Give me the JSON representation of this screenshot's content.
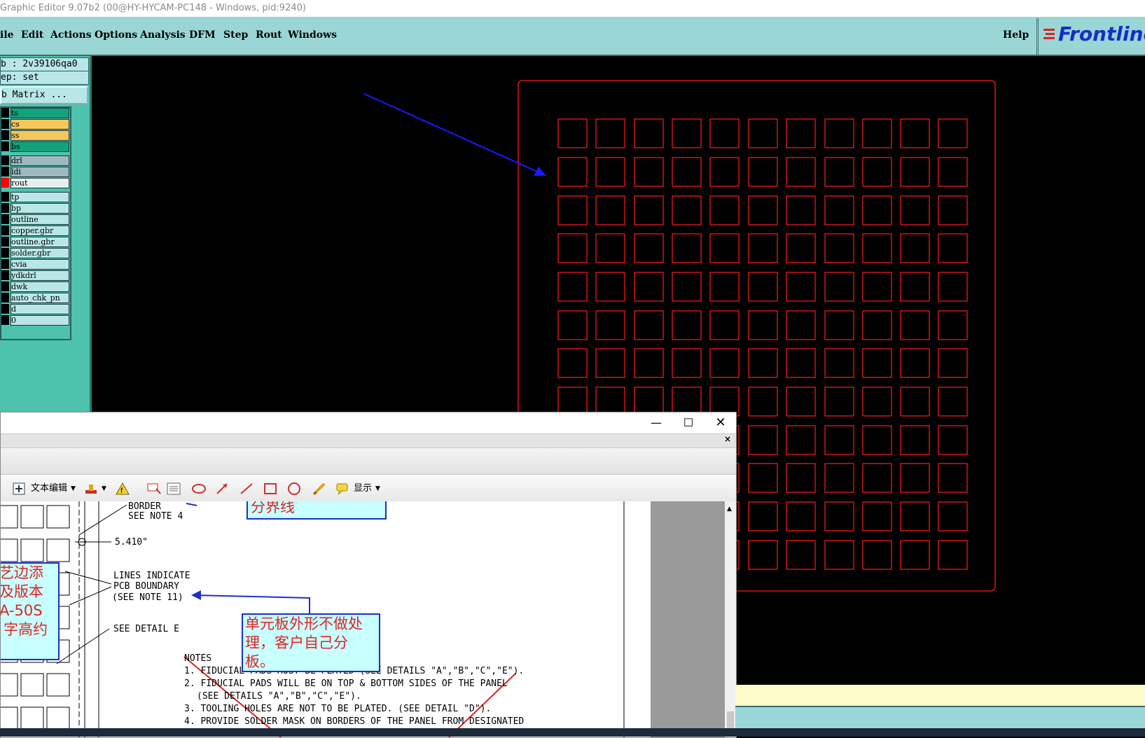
{
  "window": {
    "title": "Graphic Editor 9.07b2 (00@HY-HYCAM-PC148 - Windows, pid:9240)"
  },
  "menu": [
    "ile",
    "Edit",
    "Actions",
    "Options",
    "Analysis",
    "DFM",
    "Step",
    "Rout",
    "Windows"
  ],
  "help_label": "Help",
  "logo_text": "Frontline",
  "job": {
    "job_line": "b : 2v39106qa0",
    "step_line": "ep: set",
    "matrix_button": "b Matrix ..."
  },
  "layers": [
    {
      "name": "ts",
      "color": "#12a37d"
    },
    {
      "name": "cs",
      "color": "#f6c65a"
    },
    {
      "name": "ss",
      "color": "#f6c65a"
    },
    {
      "name": "bs",
      "color": "#12a37d"
    },
    {
      "name": "drl",
      "color": "#9db9bf"
    },
    {
      "name": "ldi",
      "color": "#9db9bf"
    },
    {
      "name": "rout",
      "color": "#e6eeee"
    },
    {
      "name": "tp",
      "color": "#b9e6e6"
    },
    {
      "name": "bp",
      "color": "#b9e6e6"
    },
    {
      "name": "outline",
      "color": "#b9e6e6"
    },
    {
      "name": "copper.gbr",
      "color": "#b9e6e6"
    },
    {
      "name": "outline.gbr",
      "color": "#b9e6e6"
    },
    {
      "name": "solder.gbr",
      "color": "#b9e6e6"
    },
    {
      "name": "cvia",
      "color": "#b9e6e6"
    },
    {
      "name": "ydkdrl",
      "color": "#b9e6e6"
    },
    {
      "name": "dwk",
      "color": "#b9e6e6"
    },
    {
      "name": "auto_chk_pn",
      "color": "#b9e6e6"
    },
    {
      "name": "d",
      "color": "#b9e6e6"
    },
    {
      "name": "0",
      "color": "#b9e6e6"
    }
  ],
  "pdf": {
    "toolbar": {
      "text_edit": "文本编辑",
      "show": "显示"
    },
    "labels": {
      "border": "BORDER",
      "see_note4": "SEE NOTE 4",
      "dim": "5.410\"",
      "lines1": "LINES INDICATE",
      "lines2": "PCB BOUNDARY",
      "lines3": "(SEE NOTE 11)",
      "see_detail": "SEE   DETAIL E",
      "notes": "NOTES",
      "note1": "1. FIDUCIAL PADS MUST BE PLATED (SEE DETAILS \"A\",\"B\",\"C\",\"E\").",
      "note2": "2. FIDUCIAL PADS WILL BE ON TOP & BOTTOM SIDES OF THE PANEL",
      "note2b": "(SEE DETAILS \"A\",\"B\",\"C\",\"E\").",
      "note3": "3. TOOLING HOLES ARE NOT TO BE PLATED. (SEE DETAIL \"D\").",
      "note4": "4. PROVIDE SOLDER MASK ON BORDERS OF THE PANEL FROM DESIGNATED"
    },
    "annotations": {
      "top": "分界线",
      "left1": "艺边添",
      "left2": "及版本",
      "left3": "A-50S",
      "left4": "字高约",
      "center1": "单元板外形不做处",
      "center2": "理，客户自己分",
      "center3": "板。"
    }
  }
}
